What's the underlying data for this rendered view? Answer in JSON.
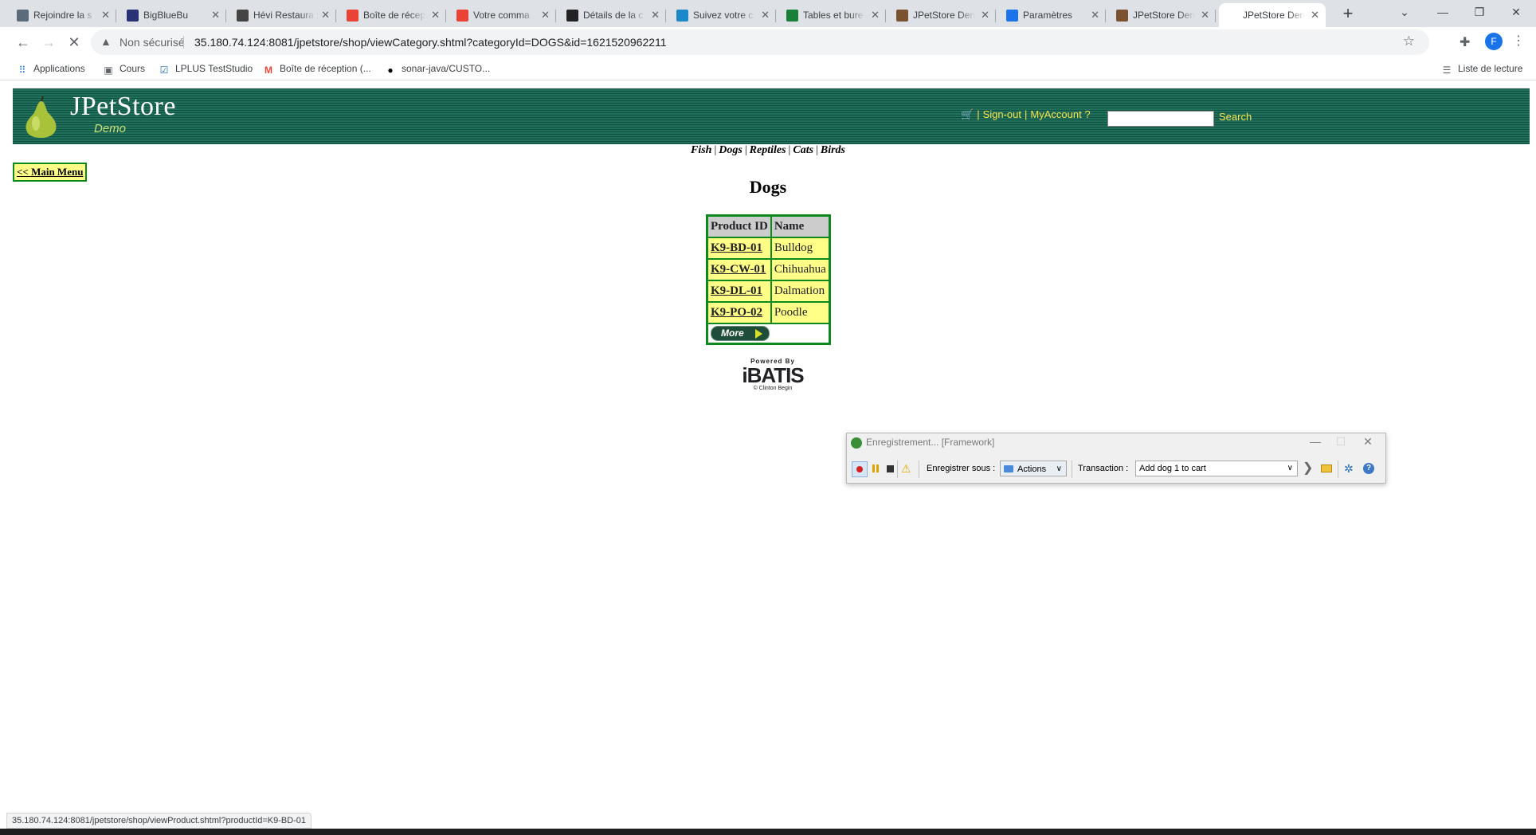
{
  "browser": {
    "tabs": [
      {
        "label": "Rejoindre la s",
        "icon": "video-meeting-icon",
        "color": "#5b6b7a"
      },
      {
        "label": "BigBlueBu",
        "icon": "bigbluebutton-icon",
        "color": "#283274"
      },
      {
        "label": "Hévi Restaura",
        "icon": "box-icon",
        "color": "#444444"
      },
      {
        "label": "Boîte de récep",
        "icon": "gmail-icon",
        "color": "#ea4335"
      },
      {
        "label": "Votre comma",
        "icon": "gmail-icon",
        "color": "#ea4335"
      },
      {
        "label": "Détails de la c",
        "icon": "amazon-icon",
        "color": "#222222"
      },
      {
        "label": "Suivez votre c",
        "icon": "package-icon",
        "color": "#1a88c9"
      },
      {
        "label": "Tables et bure",
        "icon": "sheet-icon",
        "color": "#188038"
      },
      {
        "label": "JPetStore Den",
        "icon": "page-icon",
        "color": "#7a5230"
      },
      {
        "label": "Paramètres",
        "icon": "settings-gear-icon",
        "color": "#1a73e8"
      },
      {
        "label": "JPetStore Den",
        "icon": "page-icon",
        "color": "#7a5230"
      },
      {
        "label": "JPetStore Den",
        "icon": "none",
        "color": "#ffffff"
      }
    ],
    "security_label": "Non sécurisé",
    "url": "35.180.74.124:8081/jpetstore/shop/viewCategory.shtml?categoryId=DOGS&id=1621520962211",
    "profile_initial": "F",
    "bookmarks": [
      {
        "label": "Applications",
        "icon": "apps-grid-icon"
      },
      {
        "label": "Cours",
        "icon": "folder-icon"
      },
      {
        "label": "LPLUS TestStudio",
        "icon": "checkbox-icon"
      },
      {
        "label": "Boîte de réception (...",
        "icon": "gmail-icon"
      },
      {
        "label": "sonar-java/CUSTO...",
        "icon": "github-icon"
      }
    ],
    "reading_list": "Liste de lecture",
    "status_url": "35.180.74.124:8081/jpetstore/shop/viewProduct.shtml?productId=K9-BD-01"
  },
  "store": {
    "logo_title": "JPetStore",
    "logo_subtitle": "Demo",
    "signout": "Sign-out",
    "account": "MyAccount",
    "help": "?",
    "search": "Search",
    "quick_links": [
      "Fish",
      "Dogs",
      "Reptiles",
      "Cats",
      "Birds"
    ],
    "main_menu": "<< Main Menu",
    "category_title": "Dogs",
    "columns": [
      "Product ID",
      "Name"
    ],
    "products": [
      {
        "id": "K9-BD-01",
        "name": "Bulldog"
      },
      {
        "id": "K9-CW-01",
        "name": "Chihuahua"
      },
      {
        "id": "K9-DL-01",
        "name": "Dalmation"
      },
      {
        "id": "K9-PO-02",
        "name": "Poodle"
      }
    ],
    "more": "More",
    "powered_by": "Powered By",
    "ibatis": "iBATIS",
    "copyright": "© Clinton Begin"
  },
  "recorder": {
    "title": "Enregistrement... [Framework]",
    "save_as_label": "Enregistrer sous :",
    "actions_value": "Actions",
    "transaction_label": "Transaction :",
    "transaction_value": "Add dog 1 to cart"
  }
}
